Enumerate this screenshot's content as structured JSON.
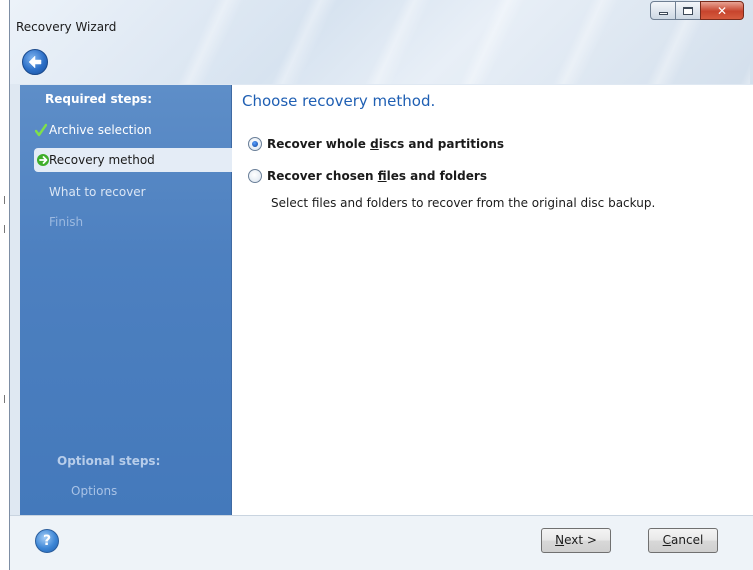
{
  "window": {
    "title": "Recovery Wizard"
  },
  "sidebar": {
    "required_heading": "Required steps:",
    "items": [
      {
        "label": "Archive selection",
        "state": "done"
      },
      {
        "label": "Recovery method",
        "state": "current"
      },
      {
        "label": "What to recover",
        "state": "link"
      },
      {
        "label": "Finish",
        "state": "disabled"
      }
    ],
    "optional_heading": "Optional steps:",
    "optional_items": [
      {
        "label": "Options"
      }
    ]
  },
  "main": {
    "heading": "Choose recovery method.",
    "options": [
      {
        "label_pre": "Recover whole ",
        "label_ul": "d",
        "label_post": "iscs and partitions",
        "selected": true
      },
      {
        "label_pre": "Recover chosen ",
        "label_ul": "f",
        "label_post": "iles and folders",
        "selected": false
      }
    ],
    "description": "Select files and folders to recover from the original disc backup."
  },
  "footer": {
    "next_ul": "N",
    "next_rest": "ext >",
    "cancel_ul": "C",
    "cancel_rest": "ancel",
    "help_glyph": "?"
  },
  "icons": {
    "back": "back-arrow-icon",
    "help": "help-icon",
    "done": "checkmark-icon",
    "current": "green-arrow-icon"
  },
  "colors": {
    "sidebar": "#4d80c0",
    "heading": "#1f5fb3",
    "close": "#c7442d"
  }
}
